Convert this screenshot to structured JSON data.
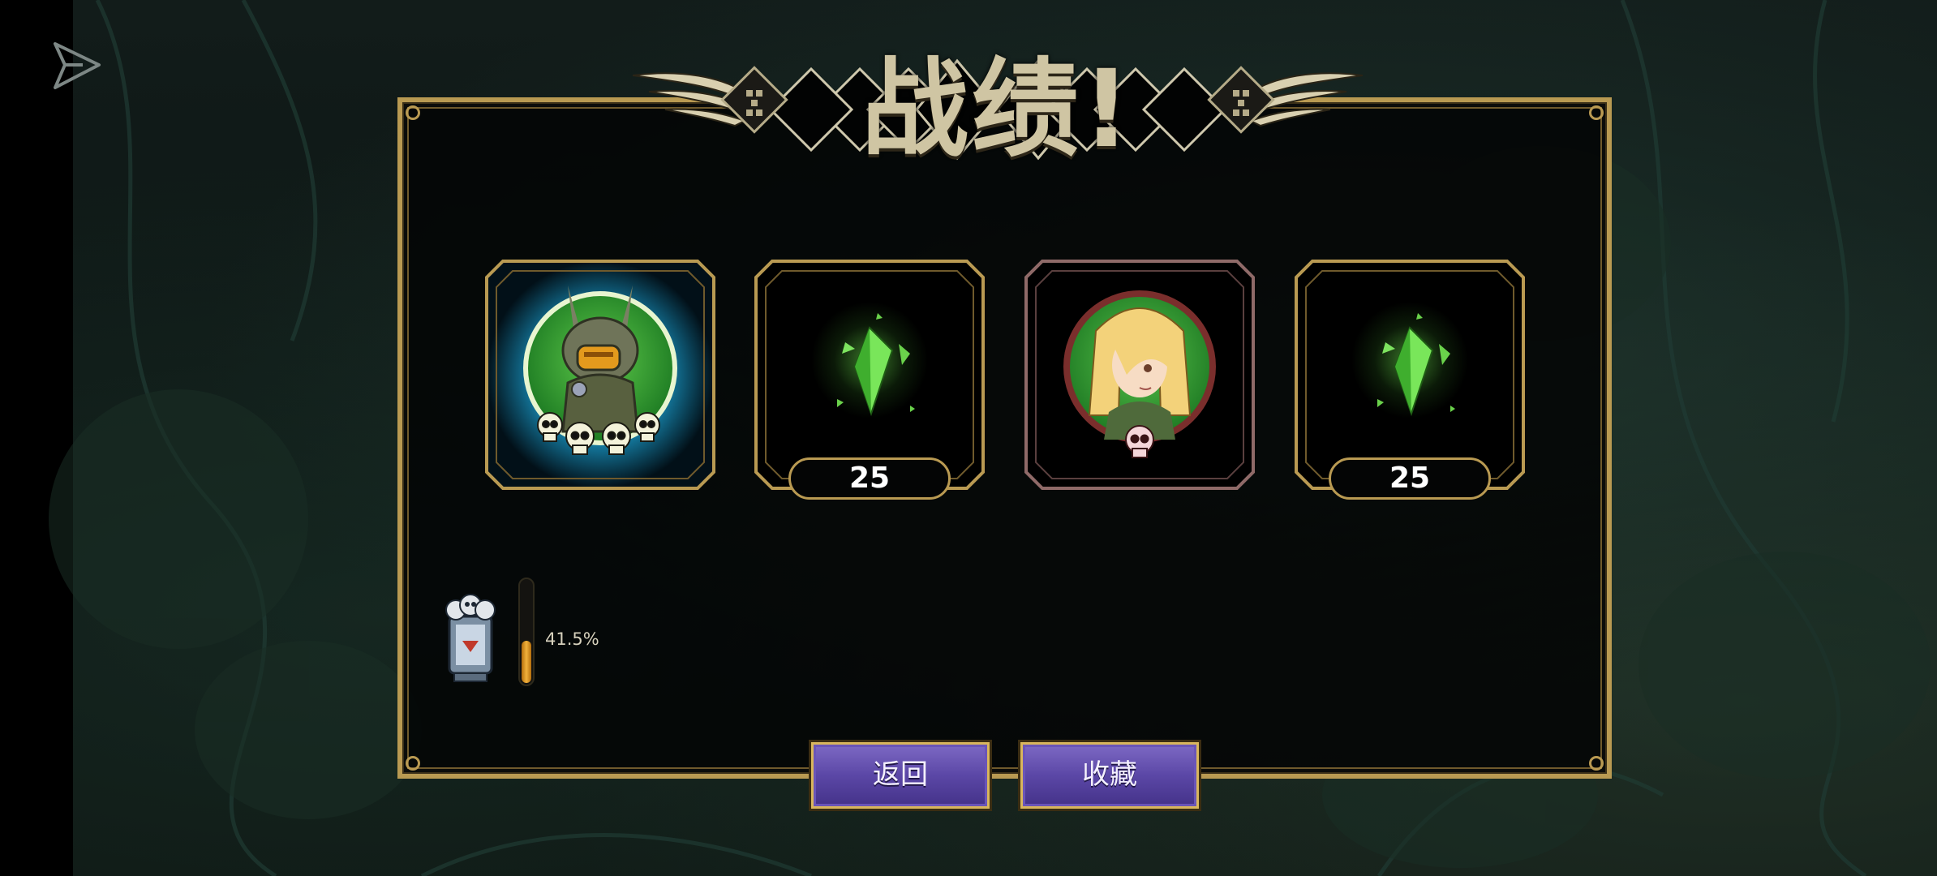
{
  "title": "战绩!",
  "rewards": [
    {
      "kind": "character",
      "icon": "armored-robot-portrait-icon",
      "skulls": 4,
      "count": ""
    },
    {
      "kind": "crystal",
      "icon": "green-crystal-icon",
      "count": "25"
    },
    {
      "kind": "character",
      "icon": "blonde-girl-portrait-icon",
      "skulls": 1,
      "count": ""
    },
    {
      "kind": "crystal",
      "icon": "green-crystal-icon",
      "count": "25"
    }
  ],
  "progress": {
    "label": "41.5%",
    "fraction": 0.415,
    "icon": "skull-trophy-icon"
  },
  "buttons": {
    "back": "返回",
    "collect": "收藏"
  },
  "colors": {
    "gold": "#b99a52",
    "button": "#5b47a6",
    "crystal": "#5fd24a",
    "glow": "#2ec4ff"
  }
}
